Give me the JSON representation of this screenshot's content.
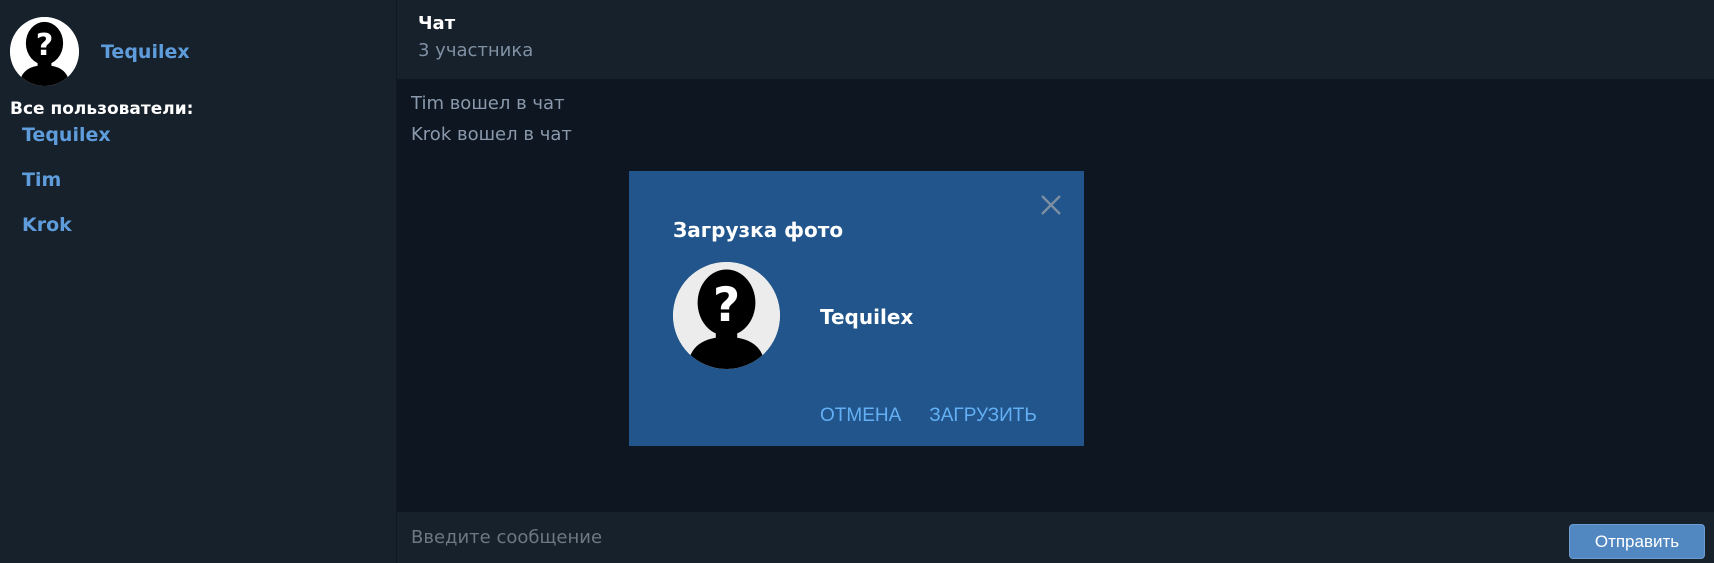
{
  "sidebar": {
    "profile": {
      "name": "Tequilex",
      "avatar_icon": "unknown-user-icon"
    },
    "users_heading": "Все пользователи:",
    "users": [
      "Tequilex",
      "Tim",
      "Krok"
    ]
  },
  "header": {
    "title": "Чат",
    "subtitle": "3 участника"
  },
  "messages": [
    "Tim вошел в чат",
    "Krok вошел в чат"
  ],
  "composer": {
    "placeholder": "Введите сообщение",
    "send_label": "Отправить"
  },
  "modal": {
    "title": "Загрузка фото",
    "username": "Tequilex",
    "avatar_icon": "unknown-user-icon",
    "close_icon": "close-icon",
    "cancel_label": "ОТМЕНА",
    "upload_label": "ЗАГРУЗИТЬ"
  },
  "colors": {
    "background": "#0e1621",
    "panel": "#17212b",
    "accent": "#5e9cdb",
    "modal": "#21558b",
    "modal_link": "#64b0f5",
    "send_button": "#5288c1"
  }
}
